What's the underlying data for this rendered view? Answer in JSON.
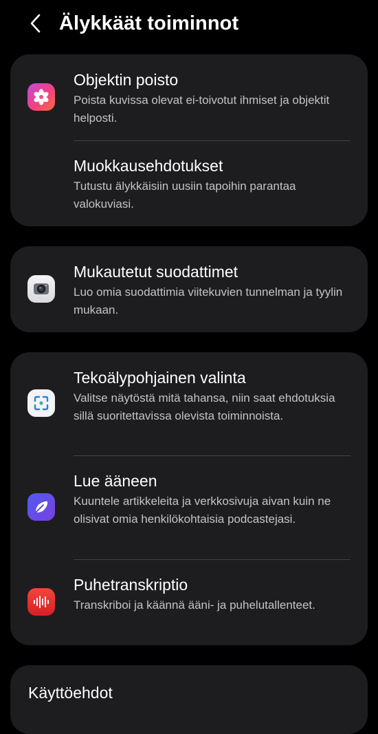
{
  "header": {
    "title": "Älykkäät toiminnot"
  },
  "cards": [
    {
      "items": [
        {
          "title": "Objektin poisto",
          "description": "Poista kuvissa olevat ei-toivotut ihmiset ja objektit helposti.",
          "icon": "flower-icon"
        },
        {
          "title": "Muokkausehdotukset",
          "description": "Tutustu älykkäisiin uusiin tapoihin parantaa valokuviasi."
        }
      ]
    },
    {
      "items": [
        {
          "title": "Mukautetut suodattimet",
          "description": "Luo omia suodattimia viitekuvien tunnelman ja tyylin mukaan.",
          "icon": "camera-icon"
        }
      ]
    },
    {
      "items": [
        {
          "title": "Tekoälypohjainen valinta",
          "description": "Valitse näytöstä mitä tahansa, niin saat ehdotuksia sillä suoritettavissa olevista toiminnoista.",
          "icon": "selection-icon"
        },
        {
          "title": "Lue ääneen",
          "description": "Kuuntele artikkeleita ja verkkosivuja aivan kuin ne olisivat omia henkilökohtaisia podcastejasi.",
          "icon": "read-aloud-icon"
        },
        {
          "title": "Puhetranskriptio",
          "description": "Transkriboi ja käännä ääni- ja puhelutallenteet.",
          "icon": "soundwave-icon"
        }
      ]
    },
    {
      "items": [
        {
          "title": "Käyttöehdot"
        }
      ]
    }
  ],
  "colors": {
    "background": "#000000",
    "card": "#1d1d1f",
    "divider": "#434345",
    "text_primary": "#ffffff",
    "text_secondary": "#c4c4c6"
  }
}
